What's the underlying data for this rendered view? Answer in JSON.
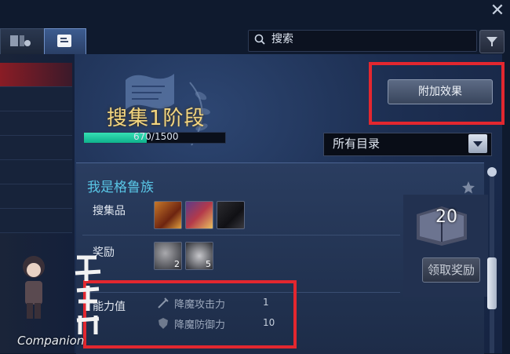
{
  "search": {
    "placeholder": "搜索"
  },
  "collection": {
    "title": "搜集1阶段",
    "progress": {
      "current": 670,
      "total": 1500,
      "text": "670/1500",
      "fraction": 0.447
    }
  },
  "buttons": {
    "effects": "附加效果",
    "claim": "领取奖励"
  },
  "category_select": {
    "selected": "所有目录"
  },
  "entry": {
    "title": "我是格鲁族",
    "items_label": "搜集品",
    "reward_label": "奖励",
    "stats_label": "能力值",
    "reward_counts": [
      "2",
      "5"
    ],
    "book_count": "20",
    "stats": [
      {
        "name": "降魔攻击力",
        "value": "1"
      },
      {
        "name": "降魔防御力",
        "value": "10"
      }
    ]
  },
  "watermark": {
    "text": "Companion"
  },
  "colors": {
    "accent_title": "#f3d57f",
    "entry_title": "#59c6e6",
    "progress": "#1fc9a0",
    "annotation": "#e3272f"
  }
}
